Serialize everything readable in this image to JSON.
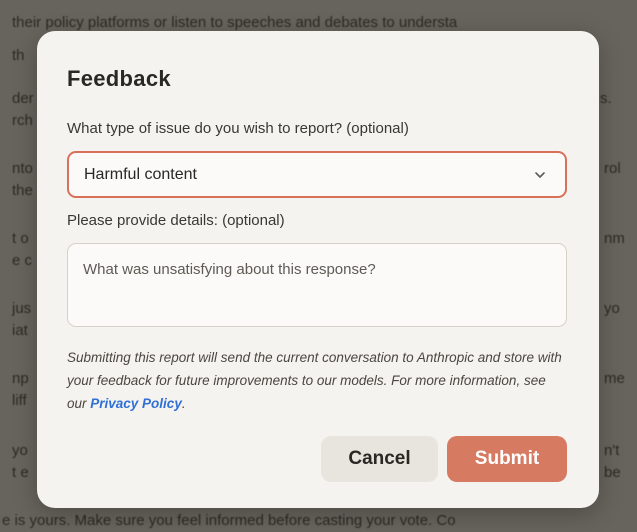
{
  "background": {
    "top_line": "their policy platforms or listen to speeches and debates to understa",
    "left_fragments": [
      "th",
      "der",
      "rch",
      "nto",
      "the",
      "t o",
      "e c",
      "jus",
      "iat",
      "np",
      "liff",
      "yo",
      "t e"
    ],
    "right_fragments": [
      "s.",
      "rol",
      "nm",
      "yo",
      "me",
      "n't",
      "be"
    ],
    "bottom_line": "e is yours. Make sure you feel informed before casting your vote. Co"
  },
  "dialog": {
    "title": "Feedback",
    "issue_label": "What type of issue do you wish to report? (optional)",
    "issue_value": "Harmful content",
    "details_label": "Please provide details: (optional)",
    "details_placeholder": "What was unsatisfying about this response?",
    "note_text": "Submitting this report will send the current conversation to Anthropic and store with your feedback for future improvements to our models. For more information, see our ",
    "note_link": "Privacy Policy",
    "note_end": ".",
    "cancel_label": "Cancel",
    "submit_label": "Submit"
  },
  "colors": {
    "accent": "#d77a62",
    "link": "#2f6fd6",
    "dialog_bg": "#f5f3ef"
  },
  "icons": {
    "select_chevron": "chevron-down-icon"
  }
}
